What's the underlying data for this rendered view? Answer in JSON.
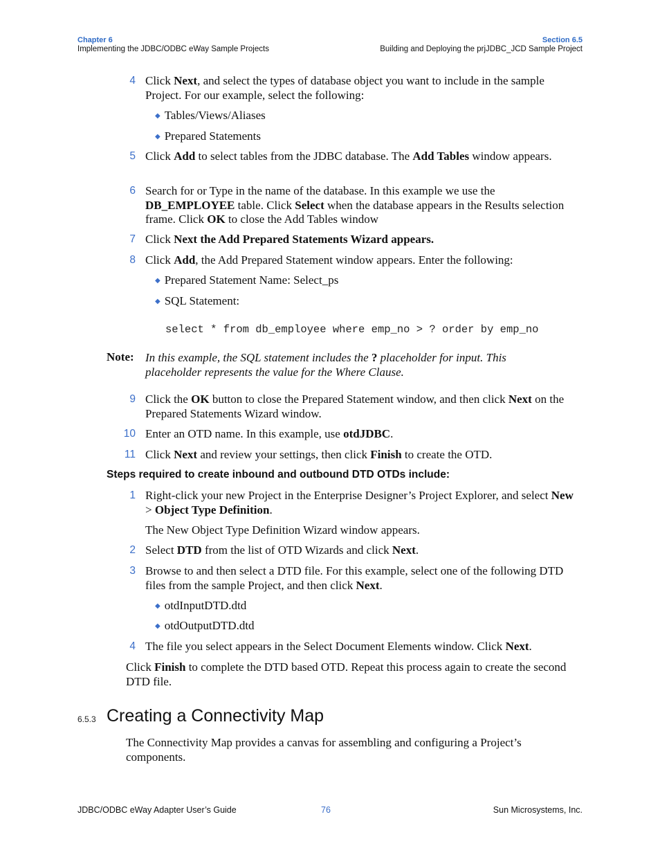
{
  "header": {
    "chapter_label": "Chapter 6",
    "chapter_title": "Implementing the JDBC/ODBC eWay Sample Projects",
    "section_label": "Section 6.5",
    "section_title": "Building and Deploying the prjJDBC_JCD Sample Project"
  },
  "steps_a": [
    {
      "num": "4",
      "parts": [
        [
          "t",
          "Click "
        ],
        [
          "b",
          "Next"
        ],
        [
          "t",
          ", and select the types of database object you want to include in the sample Project. For our example, select the following:"
        ]
      ]
    },
    {
      "num": "5",
      "parts": [
        [
          "t",
          "Click "
        ],
        [
          "b",
          "Add"
        ],
        [
          "t",
          " to select tables from the JDBC database. The "
        ],
        [
          "b",
          "Add Tables"
        ],
        [
          "t",
          " window appears."
        ]
      ]
    },
    {
      "num": "6",
      "parts": [
        [
          "t",
          "Search for or Type in the name of the database. In this example we use the "
        ],
        [
          "b",
          "DB_EMPLOYEE"
        ],
        [
          "t",
          " table. Click "
        ],
        [
          "b",
          "Select"
        ],
        [
          "t",
          " when the database appears in the Results selection frame. Click "
        ],
        [
          "b",
          "OK"
        ],
        [
          "t",
          " to close the Add Tables window"
        ]
      ]
    },
    {
      "num": "7",
      "parts": [
        [
          "t",
          "Click "
        ],
        [
          "b",
          "Next the Add Prepared Statements Wizard appears."
        ]
      ]
    },
    {
      "num": "8",
      "parts": [
        [
          "t",
          "Click "
        ],
        [
          "b",
          "Add"
        ],
        [
          "t",
          ", the Add Prepared Statement window appears. Enter the following:"
        ]
      ]
    },
    {
      "num": "9",
      "parts": [
        [
          "t",
          "Click the "
        ],
        [
          "b",
          "OK"
        ],
        [
          "t",
          " button to close the Prepared Statement window, and then click "
        ],
        [
          "b",
          "Next"
        ],
        [
          "t",
          " on the Prepared Statements Wizard window."
        ]
      ]
    },
    {
      "num": "10",
      "parts": [
        [
          "t",
          "Enter an OTD name. In this example, use "
        ],
        [
          "b",
          "otdJDBC"
        ],
        [
          "t",
          "."
        ]
      ]
    },
    {
      "num": "11",
      "parts": [
        [
          "t",
          "Click "
        ],
        [
          "b",
          "Next"
        ],
        [
          "t",
          " and review your settings, then click "
        ],
        [
          "b",
          "Finish"
        ],
        [
          "t",
          " to create the OTD."
        ]
      ]
    }
  ],
  "bullets_step4": [
    "Tables/Views/Aliases",
    "Prepared Statements"
  ],
  "bullets_step8": [
    "Prepared Statement Name: Select_ps",
    "SQL Statement:"
  ],
  "sql_statement": "select * from db_employee where emp_no > ? order by emp_no",
  "note": {
    "label": "Note:",
    "before": "In this example, the SQL statement includes the ",
    "bold": "?",
    "after": " placeholder for input. This placeholder represents the value for the Where Clause."
  },
  "subheading": "Steps required to create inbound and outbound DTD OTDs include:",
  "steps_b": [
    {
      "num": "1",
      "parts": [
        [
          "t",
          "Right-click your new Project in the Enterprise Designer’s Project Explorer, and select "
        ],
        [
          "b",
          "New"
        ],
        [
          "t",
          " > "
        ],
        [
          "b",
          "Object Type Definition"
        ],
        [
          "t",
          "."
        ]
      ]
    },
    {
      "num": "2",
      "parts": [
        [
          "t",
          "Select "
        ],
        [
          "b",
          "DTD"
        ],
        [
          "t",
          " from the list of OTD Wizards and click "
        ],
        [
          "b",
          "Next"
        ],
        [
          "t",
          "."
        ]
      ]
    },
    {
      "num": "3",
      "parts": [
        [
          "t",
          "Browse to and then select a DTD file. For this example, select one of the following DTD files from the sample Project, and then click "
        ],
        [
          "b",
          "Next"
        ],
        [
          "t",
          "."
        ]
      ]
    },
    {
      "num": "4",
      "parts": [
        [
          "t",
          "The file you select appears in the Select Document Elements window. Click "
        ],
        [
          "b",
          "Next"
        ],
        [
          "t",
          "."
        ]
      ]
    }
  ],
  "step1_followup": "The New Object Type Definition Wizard window appears.",
  "bullets_step3": [
    "otdInputDTD.dtd",
    "otdOutputDTD.dtd"
  ],
  "finish_para": [
    [
      "t",
      "Click "
    ],
    [
      "b",
      "Finish"
    ],
    [
      "t",
      " to complete the DTD based OTD. Repeat this process again to create the second DTD file."
    ]
  ],
  "section": {
    "number": "6.5.3",
    "title": "Creating a Connectivity Map",
    "body": "The Connectivity Map provides a canvas for assembling and configuring a Project’s components."
  },
  "footer": {
    "left": "JDBC/ODBC eWay Adapter User’s Guide",
    "page": "76",
    "right": "Sun Microsystems, Inc."
  },
  "colors": {
    "accent": "#3c6fc9"
  }
}
